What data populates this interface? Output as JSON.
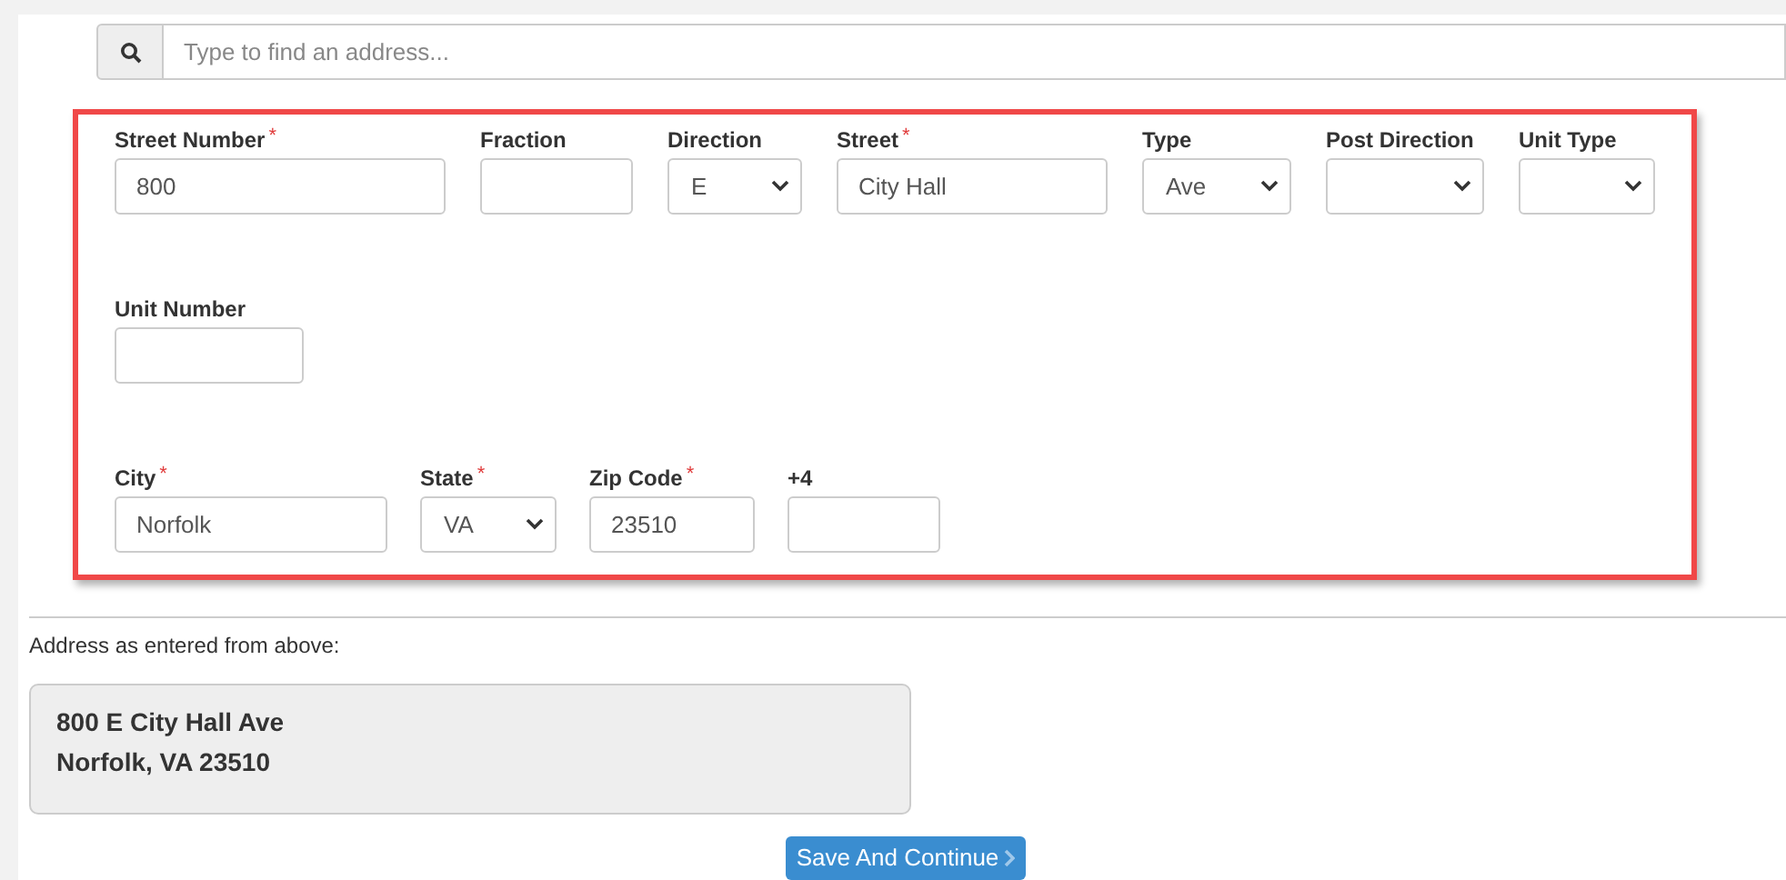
{
  "search": {
    "placeholder": "Type to find an address..."
  },
  "form": {
    "rows": [
      [
        {
          "label": "Street Number",
          "required_mark": "*",
          "kind": "text",
          "value": "800"
        },
        {
          "label": "Fraction",
          "kind": "text"
        },
        {
          "label": "Direction",
          "kind": "select",
          "value": "E"
        },
        {
          "label": "Street",
          "required_mark": "*",
          "kind": "text",
          "value": "City Hall"
        },
        {
          "label": "Type",
          "kind": "select",
          "value": "Ave"
        },
        {
          "label": "Post Direction",
          "kind": "select"
        },
        {
          "label": "Unit Type",
          "kind": "select"
        }
      ],
      [
        {
          "label": "Unit Number",
          "kind": "text"
        }
      ],
      [
        {
          "label": "City",
          "required_mark": "*",
          "kind": "text",
          "value": "Norfolk"
        },
        {
          "label": "State",
          "required_mark": "*",
          "kind": "select",
          "value": "VA"
        },
        {
          "label": "Zip Code",
          "required_mark": "*",
          "kind": "text",
          "value": "23510"
        },
        {
          "label": "+4",
          "kind": "text"
        }
      ]
    ]
  },
  "preview": {
    "label": "Address as entered from above:",
    "lines": [
      "800 E City Hall Ave",
      "Norfolk, VA 23510"
    ]
  },
  "button": {
    "label": "Save And Continue"
  }
}
